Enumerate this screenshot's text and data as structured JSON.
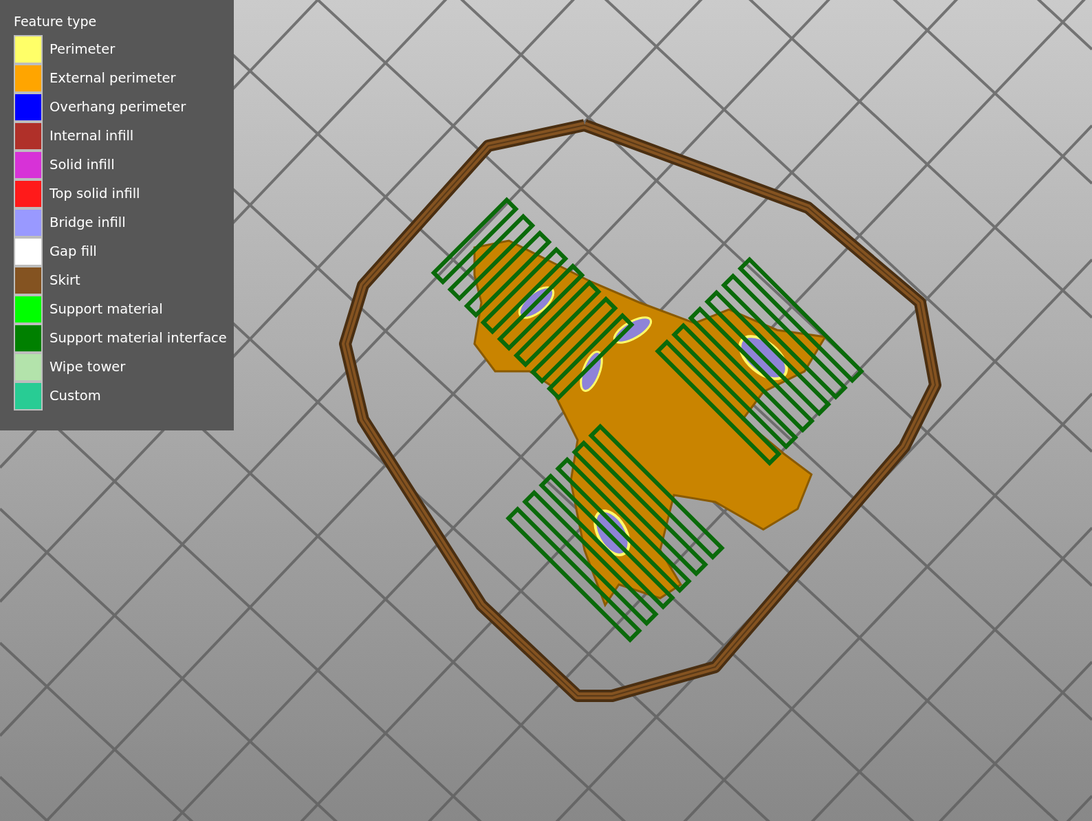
{
  "legend": {
    "title": "Feature type",
    "items": [
      {
        "label": "Perimeter",
        "color": "#ffff68"
      },
      {
        "label": "External perimeter",
        "color": "#ffa500"
      },
      {
        "label": "Overhang perimeter",
        "color": "#0000ff"
      },
      {
        "label": "Internal infill",
        "color": "#b03029"
      },
      {
        "label": "Solid infill",
        "color": "#d732d7"
      },
      {
        "label": "Top solid infill",
        "color": "#ff1a1a"
      },
      {
        "label": "Bridge infill",
        "color": "#9999ff"
      },
      {
        "label": "Gap fill",
        "color": "#ffffff"
      },
      {
        "label": "Skirt",
        "color": "#845321"
      },
      {
        "label": "Support material",
        "color": "#00ff00"
      },
      {
        "label": "Support material interface",
        "color": "#008000"
      },
      {
        "label": "Wipe tower",
        "color": "#b3e3ab"
      },
      {
        "label": "Custom",
        "color": "#28cc94"
      }
    ]
  }
}
